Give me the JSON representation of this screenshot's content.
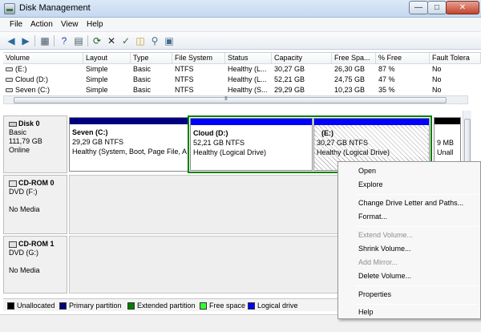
{
  "window": {
    "title": "Disk Management"
  },
  "menu": [
    "File",
    "Action",
    "View",
    "Help"
  ],
  "volume_table": {
    "columns": [
      "Volume",
      "Layout",
      "Type",
      "File System",
      "Status",
      "Capacity",
      "Free Spa...",
      "% Free",
      "Fault Tolera"
    ],
    "rows": [
      [
        "(E:)",
        "Simple",
        "Basic",
        "NTFS",
        "Healthy (L...",
        "30,27 GB",
        "26,30 GB",
        "87 %",
        "No"
      ],
      [
        "Cloud (D:)",
        "Simple",
        "Basic",
        "NTFS",
        "Healthy (L...",
        "52,21 GB",
        "24,75 GB",
        "47 %",
        "No"
      ],
      [
        "Seven (C:)",
        "Simple",
        "Basic",
        "NTFS",
        "Healthy (S...",
        "29,29 GB",
        "10,23 GB",
        "35 %",
        "No"
      ]
    ]
  },
  "disks": [
    {
      "name": "Disk 0",
      "type": "Basic",
      "size": "111,79 GB",
      "status": "Online",
      "partitions": [
        {
          "name": "Seven  (C:)",
          "size": "29,29 GB NTFS",
          "status": "Healthy (System, Boot, Page File, A"
        },
        {
          "name": "Cloud  (D:)",
          "size": "52,21 GB NTFS",
          "status": "Healthy (Logical Drive)"
        },
        {
          "name": "(E:)",
          "size": "30,27 GB NTFS",
          "status": "Healthy (Logical Drive)"
        },
        {
          "name": "",
          "size": "9 MB",
          "status": "Unall"
        }
      ]
    },
    {
      "name": "CD-ROM 0",
      "type": "DVD (F:)",
      "media": "No Media"
    },
    {
      "name": "CD-ROM 1",
      "type": "DVD (G:)",
      "media": "No Media"
    }
  ],
  "legend": [
    {
      "label": "Unallocated",
      "color": "#000000"
    },
    {
      "label": "Primary partition",
      "color": "#00007f"
    },
    {
      "label": "Extended partition",
      "color": "#007f00"
    },
    {
      "label": "Free space",
      "color": "#33ff33"
    },
    {
      "label": "Logical drive",
      "color": "#0000ff"
    }
  ],
  "context_menu": {
    "items": [
      "Open",
      "Explore",
      "Change Drive Letter and Paths...",
      "Format...",
      "Extend Volume...",
      "Shrink Volume...",
      "Add Mirror...",
      "Delete Volume...",
      "Properties",
      "Help"
    ],
    "disabled": [
      "Extend Volume...",
      "Add Mirror..."
    ]
  },
  "colors": {
    "primary": "#00007f",
    "logical": "#0000ff",
    "extended": "#007f00",
    "unallocated": "#000000"
  }
}
